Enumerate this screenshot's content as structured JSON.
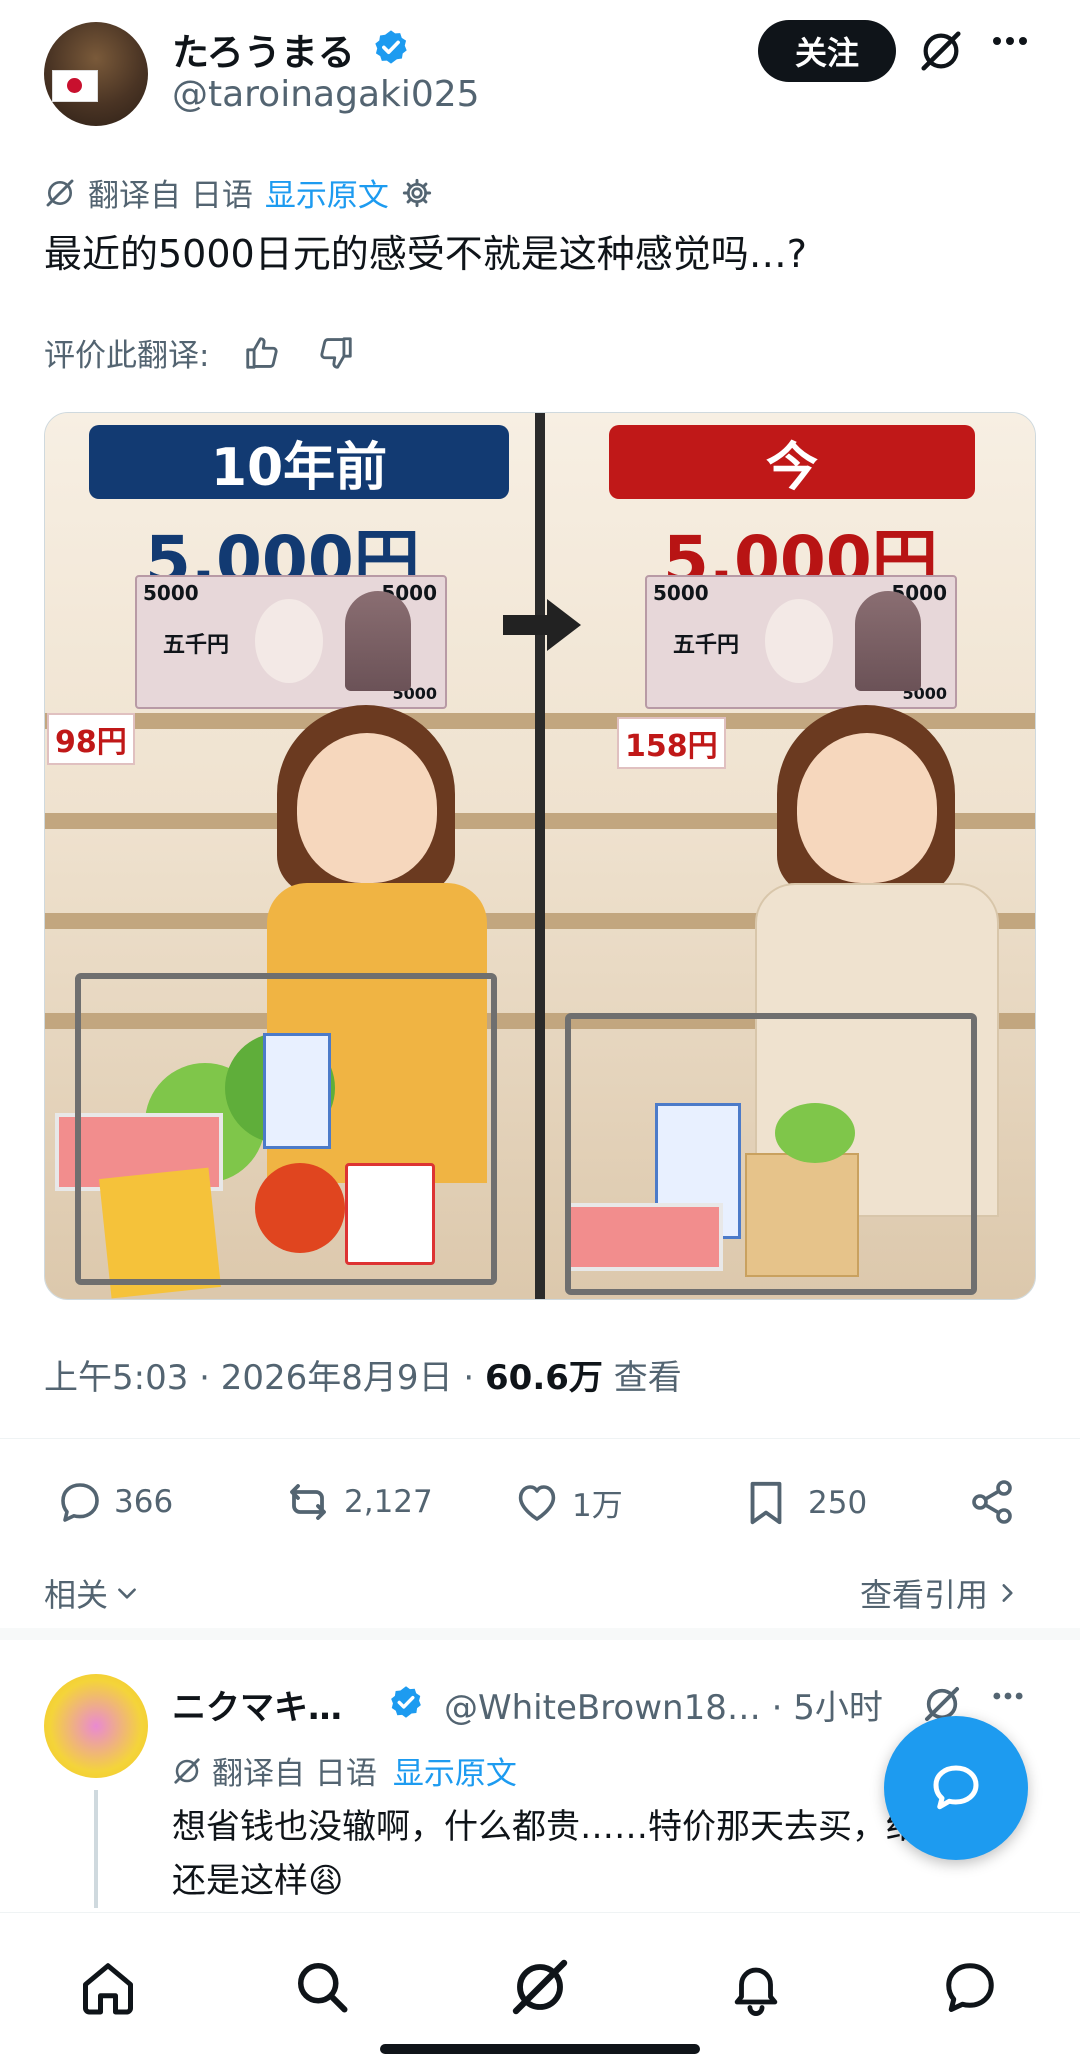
{
  "author": {
    "name": "たろうまる",
    "handle": "@taroinagaki025",
    "follow_label": "关注"
  },
  "translation": {
    "translated_from": "翻译自 日语",
    "show_original": "显示原文",
    "text": "最近的5000日元的感受不就是这种感觉吗…?",
    "rate_label": "评价此翻译:"
  },
  "image": {
    "left_title": "10年前",
    "right_title": "今",
    "left_price": "5,000円",
    "right_price": "5,000円",
    "bill_value": "5000",
    "bill_kanji": "五千円",
    "left_tag": "98円",
    "right_tag": "158円"
  },
  "meta": {
    "time": "上午5:03 · 2026年8月9日 · ",
    "views_count": "60.6万",
    "views_label": " 查看"
  },
  "actions": {
    "replies": "366",
    "reposts": "2,127",
    "likes": "1万",
    "bookmarks": "250"
  },
  "related_label": "相关",
  "quotes_label": "查看引用",
  "reply": {
    "name": "ニクマキ…",
    "handle": "@WhiteBrown18… · 5小时",
    "translated_from": "翻译自 日语",
    "show_original": "显示原文",
    "text": "想省钱也没辙啊，什么都贵……特价那天去买，结果还是这样😩"
  },
  "colors": {
    "accent": "#1d9bf0",
    "text": "#0f1419",
    "secondary": "#536471",
    "left_banner": "#123a72",
    "right_banner": "#c01818"
  },
  "icons": [
    "verified-badge-icon",
    "grok-icon",
    "more-icon",
    "translate-icon",
    "gear-icon",
    "thumbs-up-icon",
    "thumbs-down-icon",
    "reply-icon",
    "repost-icon",
    "like-icon",
    "bookmark-icon",
    "share-icon",
    "chevron-down-icon",
    "chevron-right-icon",
    "compose-icon",
    "home-icon",
    "search-icon",
    "notifications-icon",
    "messages-icon"
  ]
}
